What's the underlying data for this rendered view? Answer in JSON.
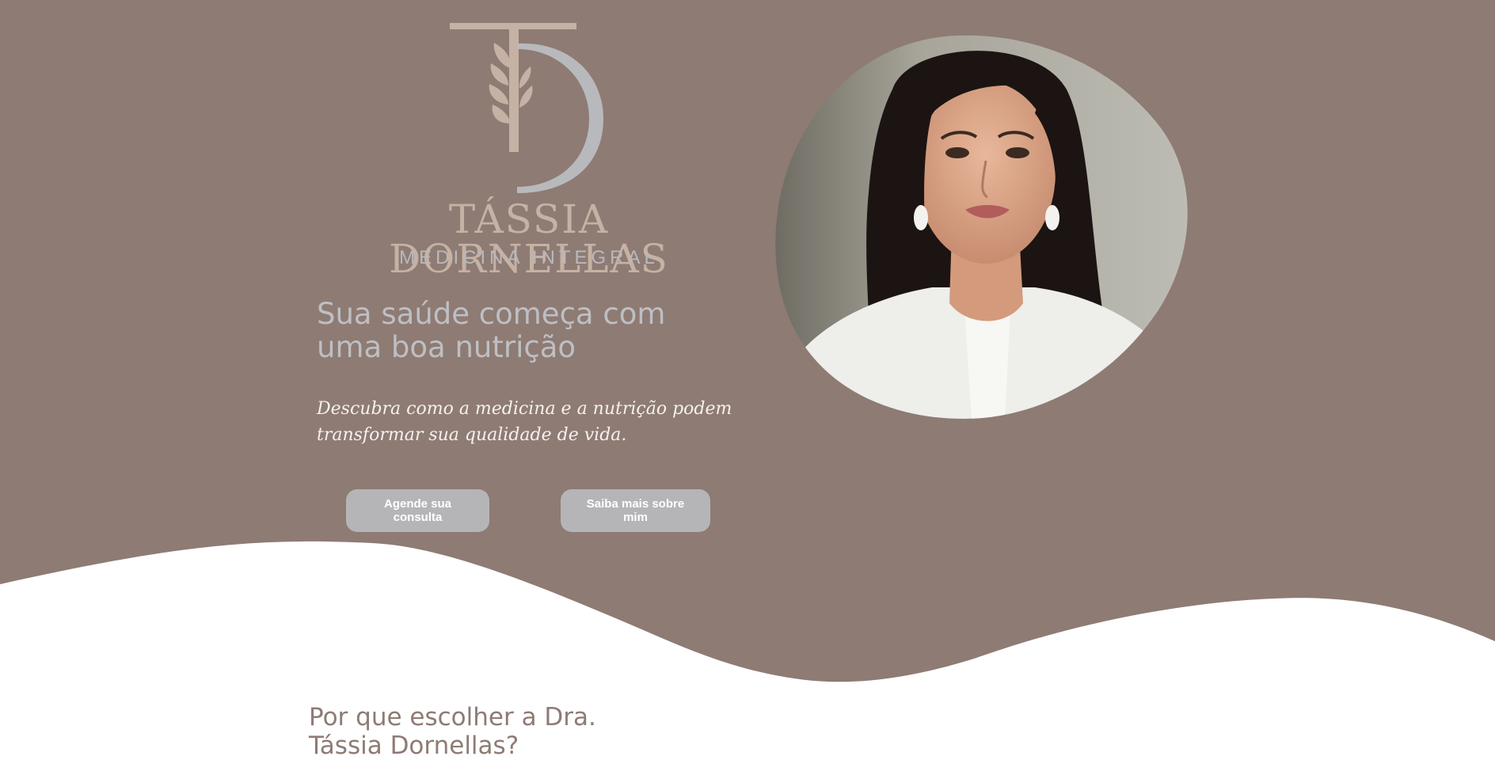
{
  "colors": {
    "hero_background": "#8e7b74",
    "wave_white": "#ffffff",
    "logo_beige": "#c6b2a4",
    "logo_silver": "#b8b9bd",
    "button_background": "#b5b5b7",
    "button_text": "#ffffff",
    "section_title": "#8e7b74"
  },
  "brand": {
    "name": "TÁSSIA DORNELLAS",
    "subtitle": "MEDICINA INTEGRAL",
    "logo_icon": "td-monogram-with-leaf-icon"
  },
  "hero": {
    "headline": "Sua saúde começa com uma boa nutrição",
    "tagline": "Descubra como a medicina e a nutrição podem transformar sua qualidade de vida.",
    "buttons": {
      "book_label": "Agende sua consulta",
      "about_label": "Saiba mais sobre mim"
    },
    "portrait_icon": "doctor-portrait-photo"
  },
  "why": {
    "title": "Por que escolher a Dra. Tássia Dornellas?"
  }
}
